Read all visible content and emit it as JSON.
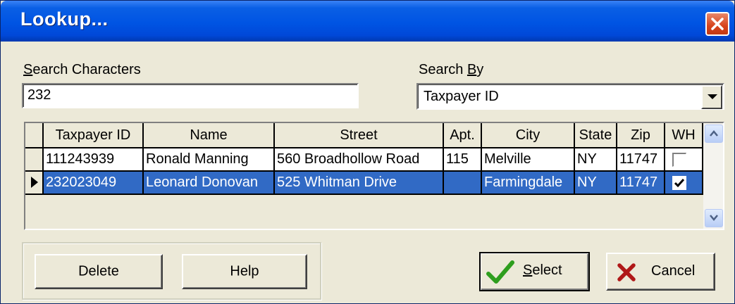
{
  "window": {
    "title": "Lookup..."
  },
  "search": {
    "chars_label_first": "S",
    "chars_label_rest": "earch Characters",
    "chars_value": "232",
    "by_label_first": "Search ",
    "by_label_accel": "B",
    "by_label_rest": "y",
    "by_value": "Taxpayer ID"
  },
  "grid": {
    "columns": [
      "Taxpayer ID",
      "Name",
      "Street",
      "Apt.",
      "City",
      "State",
      "Zip",
      "WH"
    ],
    "rows": [
      {
        "taxpayer_id": "111243939",
        "name": "Ronald Manning",
        "street": "560 Broadhollow Road",
        "apt": "115",
        "city": "Melville",
        "state": "NY",
        "zip": "11747",
        "wh": false,
        "selected": false
      },
      {
        "taxpayer_id": "232023049",
        "name": "Leonard Donovan",
        "street": "525 Whitman Drive",
        "apt": "",
        "city": "Farmingdale",
        "state": "NY",
        "zip": "11747",
        "wh": true,
        "selected": true
      }
    ]
  },
  "buttons": {
    "delete": "Delete",
    "help": "Help",
    "select_accel": "S",
    "select_rest": "elect",
    "cancel": "Cancel"
  },
  "icons": {
    "close": "close-icon",
    "select": "checkmark-icon",
    "cancel": "x-icon"
  },
  "colors": {
    "title_bar": "#0054e3",
    "selection": "#316ac5",
    "close_button": "#d7431c",
    "check_green": "#2e9e1e",
    "cancel_red": "#b01818"
  }
}
